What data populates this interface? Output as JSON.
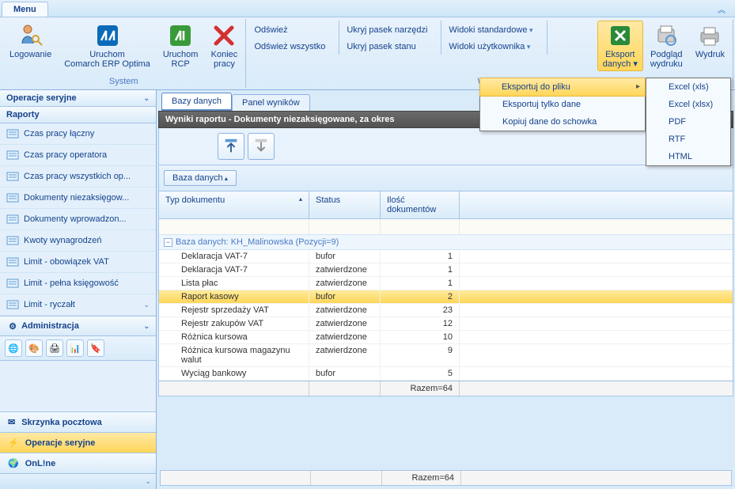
{
  "menu_tab": "Menu",
  "ribbon": {
    "system": {
      "label": "System",
      "logowanie": "Logowanie",
      "uruchom_optima": "Uruchom\nComarch ERP Optima",
      "uruchom_rcp": "Uruchom\nRCP",
      "koniec": "Koniec\npracy"
    },
    "widok": {
      "label": "Widok",
      "odswiez": "Odśwież",
      "odswiez_wszystko": "Odśwież wszystko",
      "ukryj_narzedzi": "Ukryj pasek narzędzi",
      "ukryj_stanu": "Ukryj pasek stanu",
      "widoki_std": "Widoki standardowe",
      "widoki_uzy": "Widoki użytkownika",
      "eksport": "Eksport\ndanych",
      "podglad": "Podgląd\nwydruku",
      "wydruk": "Wydruk"
    }
  },
  "export_menu": {
    "do_pliku": "Eksportuj do pliku",
    "tylko_dane": "Eksportuj tylko dane",
    "kopiuj": "Kopiuj dane do schowka"
  },
  "format_menu": {
    "xls": "Excel (xls)",
    "xlsx": "Excel (xlsx)",
    "pdf": "PDF",
    "rtf": "RTF",
    "html": "HTML"
  },
  "sidebar": {
    "section1": "Operacje seryjne",
    "section2": "Raporty",
    "reports": [
      "Czas pracy łączny",
      "Czas pracy operatora",
      "Czas pracy wszystkich op...",
      "Dokumenty niezaksięgow...",
      "Dokumenty wprowadzon...",
      "Kwoty wynagrodzeń",
      "Limit - obowiązek VAT",
      "Limit - pełna księgowość",
      "Limit - ryczałt"
    ],
    "admin": "Administracja",
    "stack": {
      "mail": "Skrzynka pocztowa",
      "ops": "Operacje seryjne",
      "online": "OnL!ne"
    }
  },
  "tabs": {
    "bazy": "Bazy danych",
    "panel": "Panel wyników"
  },
  "title": "Wyniki raportu - Dokumenty niezaksięgowane, za okres ",
  "group_by": "Baza danych",
  "columns": {
    "typ": "Typ dokumentu",
    "status": "Status",
    "ilosc": "Ilość dokumentów"
  },
  "group_header": "Baza danych: KH_Malinowska (Pozycji=9)",
  "rows": [
    {
      "typ": "Deklaracja VAT-7",
      "status": "bufor",
      "count": "1"
    },
    {
      "typ": "Deklaracja VAT-7",
      "status": "zatwierdzone",
      "count": "1"
    },
    {
      "typ": "Lista płac",
      "status": "zatwierdzone",
      "count": "1"
    },
    {
      "typ": "Raport kasowy",
      "status": "bufor",
      "count": "2",
      "selected": true
    },
    {
      "typ": "Rejestr sprzedaży VAT",
      "status": "zatwierdzone",
      "count": "23"
    },
    {
      "typ": "Rejestr zakupów VAT",
      "status": "zatwierdzone",
      "count": "12"
    },
    {
      "typ": "Różnica kursowa",
      "status": "zatwierdzone",
      "count": "10"
    },
    {
      "typ": "Różnica kursowa magazynu walut",
      "status": "zatwierdzone",
      "count": "9"
    },
    {
      "typ": "Wyciąg bankowy",
      "status": "bufor",
      "count": "5"
    }
  ],
  "razem": "Razem=64"
}
